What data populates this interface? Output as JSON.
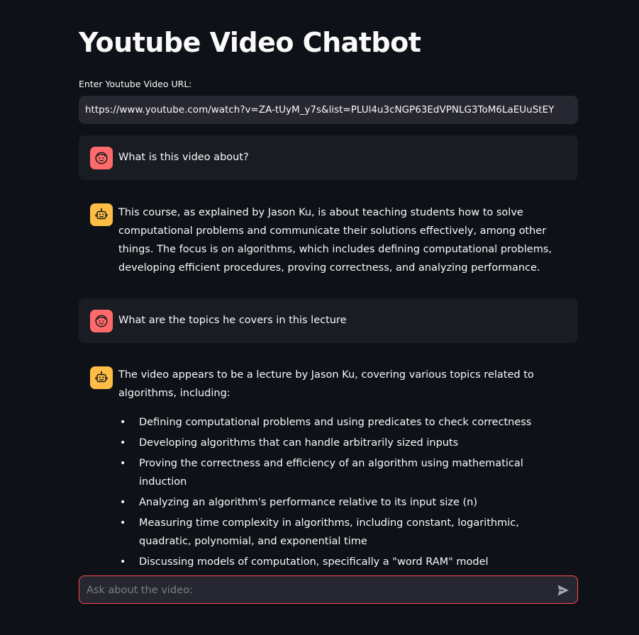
{
  "app": {
    "title": "Youtube Video Chatbot"
  },
  "url_field": {
    "label": "Enter Youtube Video URL:",
    "value": "https://www.youtube.com/watch?v=ZA-tUyM_y7s&list=PLUl4u3cNGP63EdVPNLG3ToM6LaEUuStEY"
  },
  "messages": [
    {
      "role": "user",
      "avatar_icon": "user-face-icon",
      "text": "What is this video about?"
    },
    {
      "role": "assistant",
      "avatar_icon": "robot-icon",
      "text": "This course, as explained by Jason Ku, is about teaching students how to solve computational problems and communicate their solutions effectively, among other things. The focus is on algorithms, which includes defining computational problems, developing efficient procedures, proving correctness, and analyzing performance."
    },
    {
      "role": "user",
      "avatar_icon": "user-face-icon",
      "text": "What are the topics he covers in this lecture"
    },
    {
      "role": "assistant",
      "avatar_icon": "robot-icon",
      "text": "The video appears to be a lecture by Jason Ku, covering various topics related to algorithms, including:",
      "bullets": [
        "Defining computational problems and using predicates to check correctness",
        "Developing algorithms that can handle arbitrarily sized inputs",
        "Proving the correctness and efficiency of an algorithm using mathematical induction",
        "Analyzing an algorithm's performance relative to its input size (n)",
        "Measuring time complexity in algorithms, including constant, logarithmic, quadratic, polynomial, and exponential time",
        "Discussing models of computation, specifically a \"word RAM\" model"
      ]
    }
  ],
  "chat_input": {
    "placeholder": "Ask about the video:",
    "send_icon": "send-icon"
  },
  "colors": {
    "background": "#0e1117",
    "input_bg": "#262730",
    "user_message_bg": "#1a1c24",
    "user_avatar": "#ff6b6b",
    "assistant_avatar": "#ffbd45",
    "accent_border": "#ff4b4b"
  }
}
